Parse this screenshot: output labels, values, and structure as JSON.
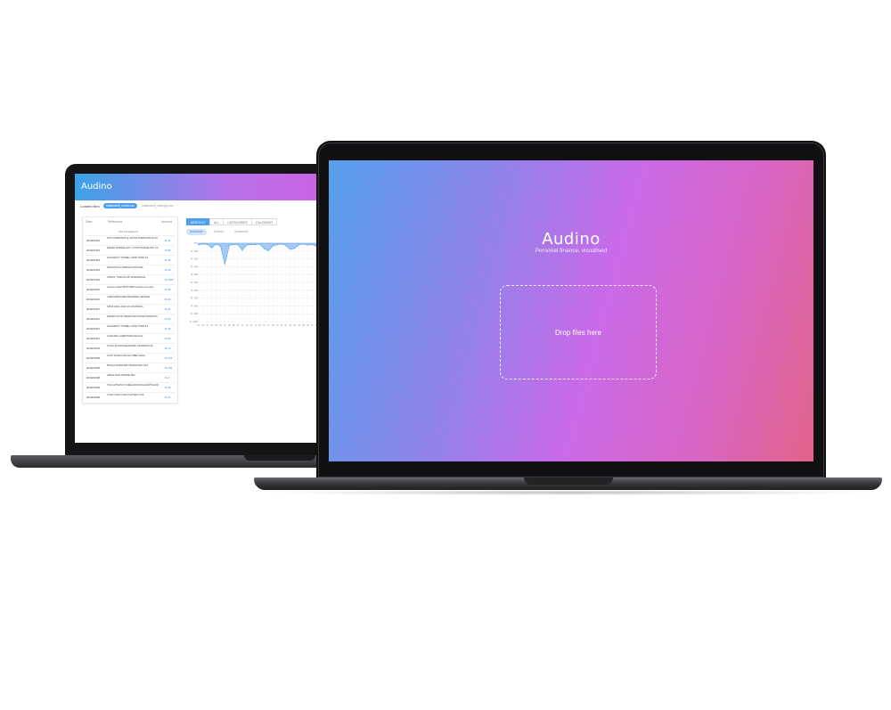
{
  "back_app": {
    "title": "Audino",
    "loaded_label": "Loaded files",
    "files": [
      "statement_credit.csv",
      "statement_savings.csv"
    ],
    "table": {
      "headers": [
        "Date",
        "Reference",
        "Amount"
      ],
      "count_label": "100 transactions",
      "rows": [
        {
          "date": "2019/10/24",
          "ref": "WTC DURBANVILLE 145782 DURBANVILLE ZA",
          "amount": "R-31"
        },
        {
          "date": "2019/10/23",
          "ref": "ENGEN MODDEL BAY 1 STOP MOSSEL BAY ZA",
          "amount": "R-80"
        },
        {
          "date": "2019/10/23",
          "ref": "HUGUENOT TUNNEL CAPE TOWN ZA",
          "amount": "R-45"
        },
        {
          "date": "2019/10/23",
          "ref": "#SNOWTICH TRANSACTION FEE",
          "amount": "R-20"
        },
        {
          "date": "2019/10/23",
          "ref": "ATMOS, TOMLOC A/F RIVERSDALE",
          "amount": "R-1000"
        },
        {
          "date": "2019/10/22",
          "ref": "Amazon Video*MT8Y48RI4 amazon.com.edu",
          "amount": "R-90"
        },
        {
          "date": "2019/10/21",
          "ref": "CHECKERS EDEN MEANDER GEORGE",
          "amount": "R-94"
        },
        {
          "date": "2019/10/21",
          "ref": "SPUR GRILL AND GO PASTBOKS",
          "amount": "R-62"
        },
        {
          "date": "2019/10/21",
          "ref": "ENGEN 1STOP WINELAND KRAAIFONTEIN ZA",
          "amount": "R-90"
        },
        {
          "date": "2019/10/21",
          "ref": "HUGUENOT TUNNEL CAPE TOWN ZA",
          "amount": "R-45"
        },
        {
          "date": "2019/10/21",
          "ref": "ALOE DELI ALBERTINIA Albertinia",
          "amount": "R-90"
        },
        {
          "date": "2019/10/19",
          "ref": "TOTAL RH MANNELDHOEK PASTBOKS ZA",
          "amount": "R-14"
        },
        {
          "date": "2019/10/18",
          "ref": "AUTO WORLD MOJAG SIBETHAGS",
          "amount": "R-278"
        },
        {
          "date": "2019/10/18",
          "ref": "BOOGA BURGUNDY BURGUNDY EST",
          "amount": "R-100"
        },
        {
          "date": "2019/10/18",
          "ref": "APPLE PAID AIRTIME R02",
          "amount": "R-2"
        },
        {
          "date": "2019/10/18",
          "ref": "TSA KAPTEIN KYLMEHAND BOOGAKAPTAHOR",
          "amount": "R-50"
        },
        {
          "date": "2019/10/18",
          "ref": "LOVE CAKE CAFE PLATTEKLOOF",
          "amount": "R-27"
        }
      ]
    },
    "tabs": [
      "MONTHLY",
      "ALL",
      "CATEGORIES",
      "CALENDAR"
    ],
    "subtabs": [
      "November",
      "October",
      "September"
    ],
    "chart_data": {
      "type": "area",
      "x": [
        "01",
        "02",
        "03",
        "04",
        "05",
        "06",
        "07",
        "08",
        "09",
        "10",
        "11",
        "12",
        "13",
        "14",
        "15",
        "16",
        "17",
        "18",
        "19",
        "20",
        "21",
        "22",
        "23",
        "24",
        "25",
        "26",
        "27",
        "28",
        "29",
        "30"
      ],
      "series": [
        {
          "values": [
            -20,
            -10,
            -15,
            -60,
            -12,
            -35,
            -270,
            -30,
            -15,
            -20,
            -90,
            -25,
            -15,
            -20,
            -10,
            -70,
            -95,
            -35,
            -20,
            -10,
            -30,
            -80,
            -65,
            -20,
            -10,
            -25,
            -15,
            -40,
            -20,
            -10
          ]
        }
      ],
      "y_ticks": [
        "R 0",
        "R -100",
        "R -200",
        "R -300",
        "R -400",
        "R -500",
        "R -600",
        "R -700",
        "R -800",
        "R -900",
        "R -1000"
      ],
      "ylim": [
        -1000,
        0
      ],
      "grid": true
    }
  },
  "front_app": {
    "title": "Audino",
    "subtitle": "Personal finance, visualised",
    "dropzone_label": "Drop files here"
  },
  "colors": {
    "accent": "#4f9ff0",
    "gradient_start": "#55a0ec",
    "gradient_mid": "#c96ae8",
    "gradient_end": "#e2648a"
  }
}
